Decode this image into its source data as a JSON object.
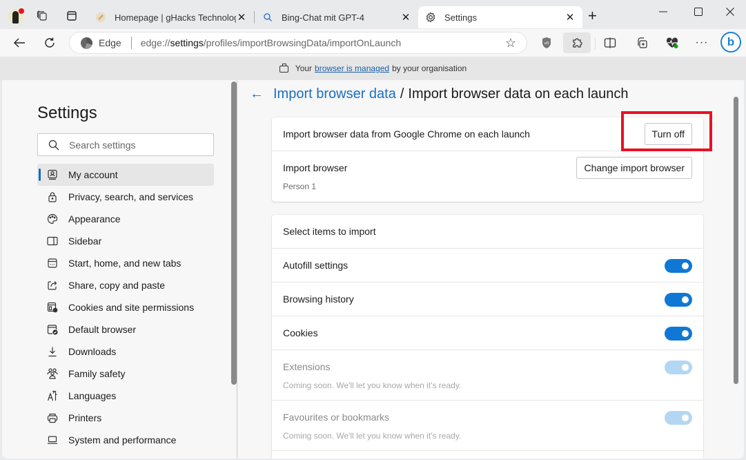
{
  "browser": {
    "tabs": [
      {
        "title": "Homepage | gHacks Technology",
        "favicon": "ghacks-icon",
        "active": false
      },
      {
        "title": "Bing-Chat mit GPT-4",
        "favicon": "search-icon",
        "active": false
      },
      {
        "title": "Settings",
        "favicon": "gear-icon",
        "active": true
      }
    ],
    "new_tab": "+",
    "window_controls": {
      "minimize": "—",
      "maximize": "☐",
      "close": "✕"
    },
    "tab_close": "✕",
    "omnibox": {
      "scheme_label": "Edge",
      "url_prefix": "edge://",
      "url_host": "settings",
      "url_path": "/profiles/importBrowsingData/importOnLaunch"
    },
    "toolbar_more": "···",
    "bing_label": "b"
  },
  "managed_bar": {
    "prefix": "Your",
    "link": "browser is managed",
    "suffix": "by your organisation"
  },
  "sidebar": {
    "title": "Settings",
    "search_placeholder": "Search settings",
    "items": [
      {
        "label": "My account",
        "icon": "account-icon",
        "active": true
      },
      {
        "label": "Privacy, search, and services",
        "icon": "lock-icon"
      },
      {
        "label": "Appearance",
        "icon": "palette-icon"
      },
      {
        "label": "Sidebar",
        "icon": "sidebar-icon"
      },
      {
        "label": "Start, home, and new tabs",
        "icon": "home-tabs-icon"
      },
      {
        "label": "Share, copy and paste",
        "icon": "share-icon"
      },
      {
        "label": "Cookies and site permissions",
        "icon": "cookies-icon"
      },
      {
        "label": "Default browser",
        "icon": "default-browser-icon"
      },
      {
        "label": "Downloads",
        "icon": "download-icon"
      },
      {
        "label": "Family safety",
        "icon": "family-icon"
      },
      {
        "label": "Languages",
        "icon": "languages-icon"
      },
      {
        "label": "Printers",
        "icon": "printer-icon"
      },
      {
        "label": "System and performance",
        "icon": "laptop-icon"
      }
    ]
  },
  "main": {
    "breadcrumb": {
      "back": "←",
      "parent": "Import browser data",
      "separator": "/",
      "current": "Import browser data on each launch"
    },
    "card1": {
      "import_on_launch_label": "Import browser data from Google Chrome on each launch",
      "turn_off_button": "Turn off",
      "import_browser_label": "Import browser",
      "import_browser_value": "Person 1",
      "change_button": "Change import browser"
    },
    "card2": {
      "header": "Select items to import",
      "items": [
        {
          "label": "Autofill settings",
          "enabled": true,
          "disabled": false
        },
        {
          "label": "Browsing history",
          "enabled": true,
          "disabled": false
        },
        {
          "label": "Cookies",
          "enabled": true,
          "disabled": false
        },
        {
          "label": "Extensions",
          "sub": "Coming soon. We'll let you know when it's ready.",
          "enabled": true,
          "disabled": true
        },
        {
          "label": "Favourites or bookmarks",
          "sub": "Coming soon. We'll let you know when it's ready.",
          "enabled": true,
          "disabled": true
        }
      ]
    }
  },
  "colors": {
    "accent": "#0f78d4",
    "link": "#1a6fc0",
    "highlight_annotation": "#e81123",
    "toggle_disabled": "#b3d7f2"
  }
}
